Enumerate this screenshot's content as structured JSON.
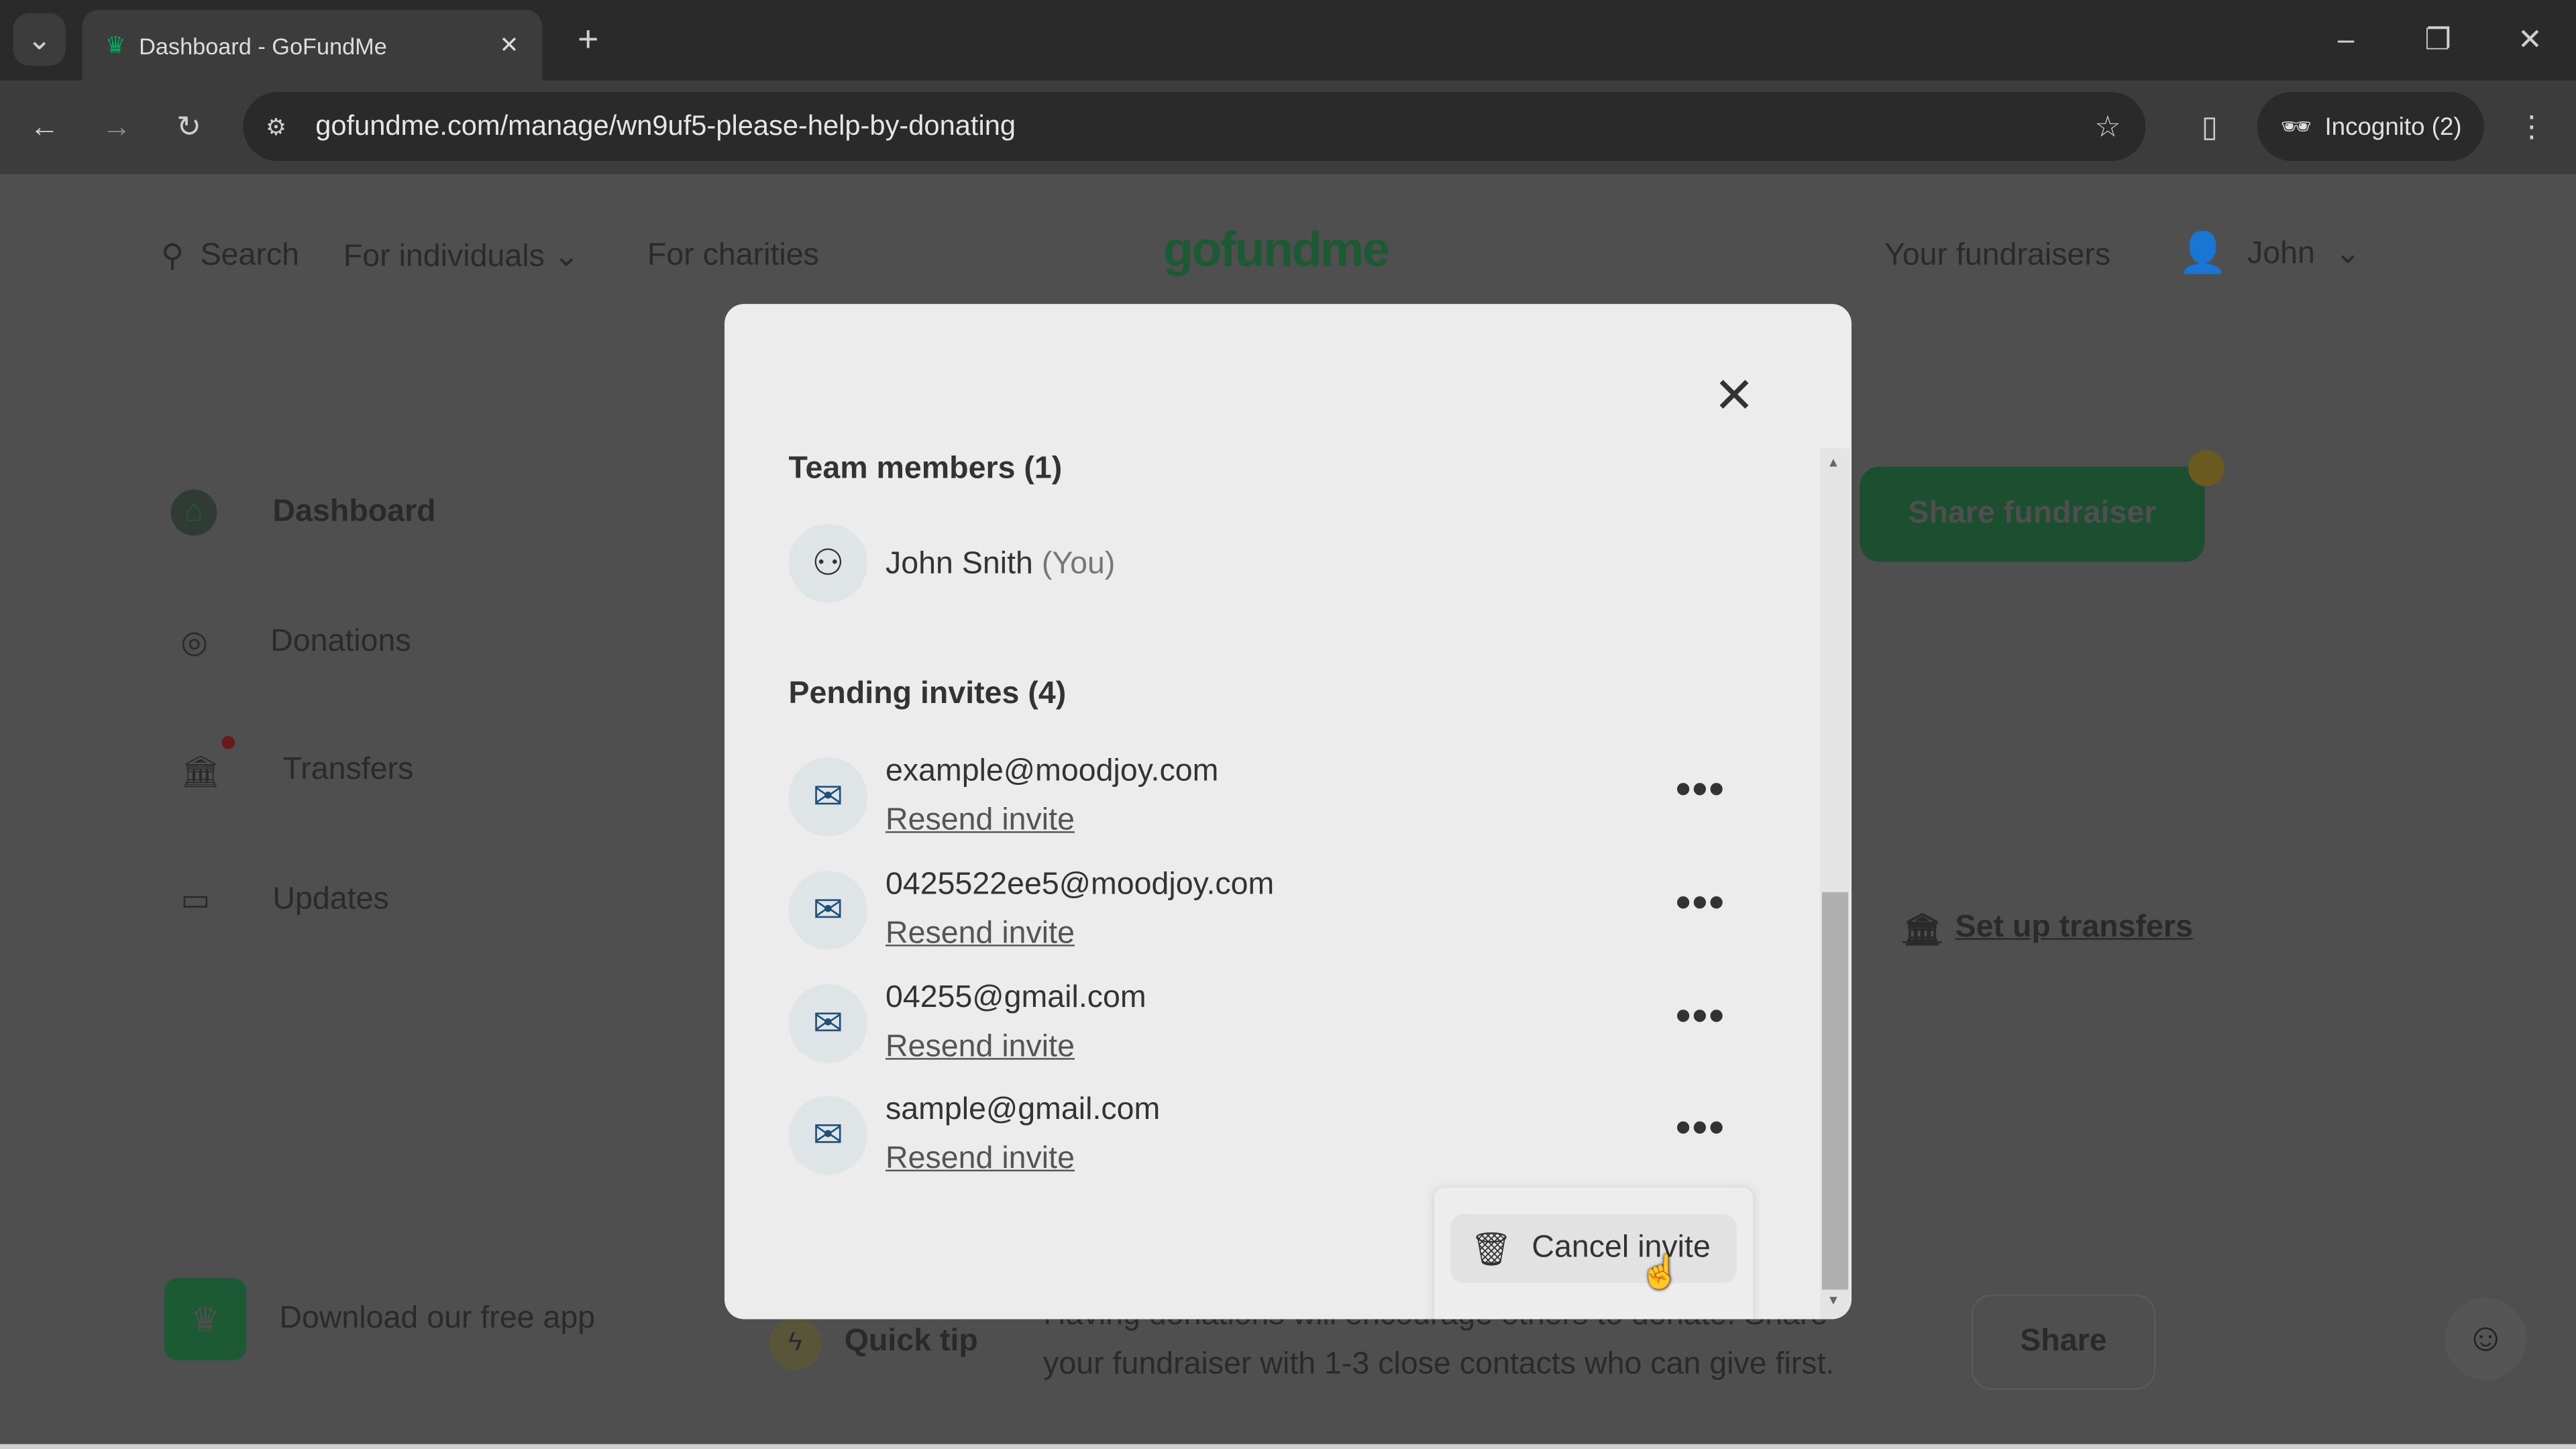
{
  "browser": {
    "tab_title": "Dashboard - GoFundMe",
    "url": "gofundme.com/manage/wn9uf5-please-help-by-donating",
    "profile": "Incognito (2)"
  },
  "site": {
    "nav": {
      "search": "Search",
      "individuals": "For individuals",
      "charities": "For charities",
      "logo": "gofundme",
      "your_fundraisers": "Your fundraisers",
      "user": "John"
    },
    "sidebar": [
      {
        "label": "Dashboard",
        "icon": "home-icon"
      },
      {
        "label": "Donations",
        "icon": "donations-icon"
      },
      {
        "label": "Transfers",
        "icon": "bank-icon"
      },
      {
        "label": "Updates",
        "icon": "updates-icon"
      }
    ],
    "download_app": "Download our free app",
    "share_fundraiser": "Share fundraiser",
    "set_up_transfers": "Set up transfers",
    "quick_tip": {
      "label": "Quick tip",
      "text_line1": "Having donations will encourage others to donate. Share",
      "text_line2": "your fundraiser with 1-3 close contacts who can give first."
    },
    "share": "Share"
  },
  "modal": {
    "team_heading": "Team members (1)",
    "member": {
      "name": "John Snith",
      "suffix": "(You)"
    },
    "pending_heading": "Pending invites (4)",
    "invites": [
      {
        "email": "example@moodjoy.com",
        "action": "Resend invite"
      },
      {
        "email": "0425522ee5@moodjoy.com",
        "action": "Resend invite"
      },
      {
        "email": "04255@gmail.com",
        "action": "Resend invite"
      },
      {
        "email": "sample@gmail.com",
        "action": "Resend invite"
      }
    ],
    "menu": {
      "cancel_invite": "Cancel invite"
    }
  },
  "colors": {
    "brand_green": "#02a95c",
    "overlay": "#4f4f4f",
    "modal_bg": "#ececec"
  }
}
